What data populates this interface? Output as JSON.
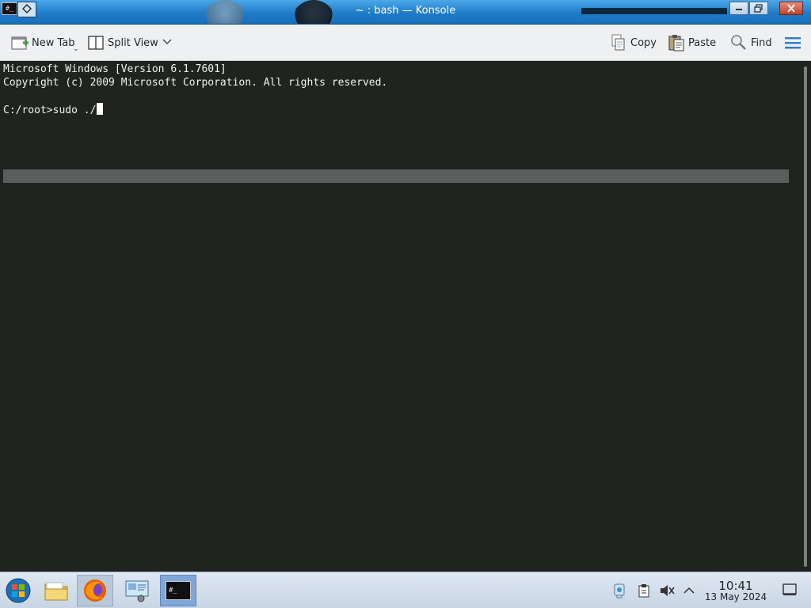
{
  "window": {
    "title": "~ : bash — Konsole",
    "app_icon_text": "#_",
    "buttons": [
      "help-icon",
      "maximize-icon",
      "restore-icon",
      "close-icon"
    ]
  },
  "toolbar": {
    "new_tab_label": "New Tab",
    "split_view_label": "Split View",
    "copy_label": "Copy",
    "paste_label": "Paste",
    "find_label": "Find",
    "menu_icon": "hamburger-icon"
  },
  "terminal": {
    "lines": [
      "Microsoft Windows [Version 6.1.7601]",
      "Copyright (c) 2009 Microsoft Corporation. All rights reserved.",
      "",
      "C:/root>sudo ./"
    ],
    "background": "#1f2421",
    "foreground": "#f2f2f2"
  },
  "taskbar": {
    "items": [
      {
        "name": "start-orb-icon"
      },
      {
        "name": "file-manager-icon"
      },
      {
        "name": "firefox-icon",
        "state": "active"
      },
      {
        "name": "remote-desktop-icon"
      },
      {
        "name": "konsole-icon",
        "state": "selected",
        "text": "#_"
      }
    ],
    "tray": [
      "network-icon",
      "clipboard-icon",
      "volume-muted-icon",
      "chevron-up-icon"
    ],
    "clock_time": "10:41",
    "clock_date": "13 May 2024",
    "show_desktop_icon": "show-desktop-icon"
  },
  "colors": {
    "titlebar": "#1f7cc9",
    "toolbar": "#eff0f1",
    "taskbar": "#d3deea",
    "accent": "#3daee9"
  }
}
